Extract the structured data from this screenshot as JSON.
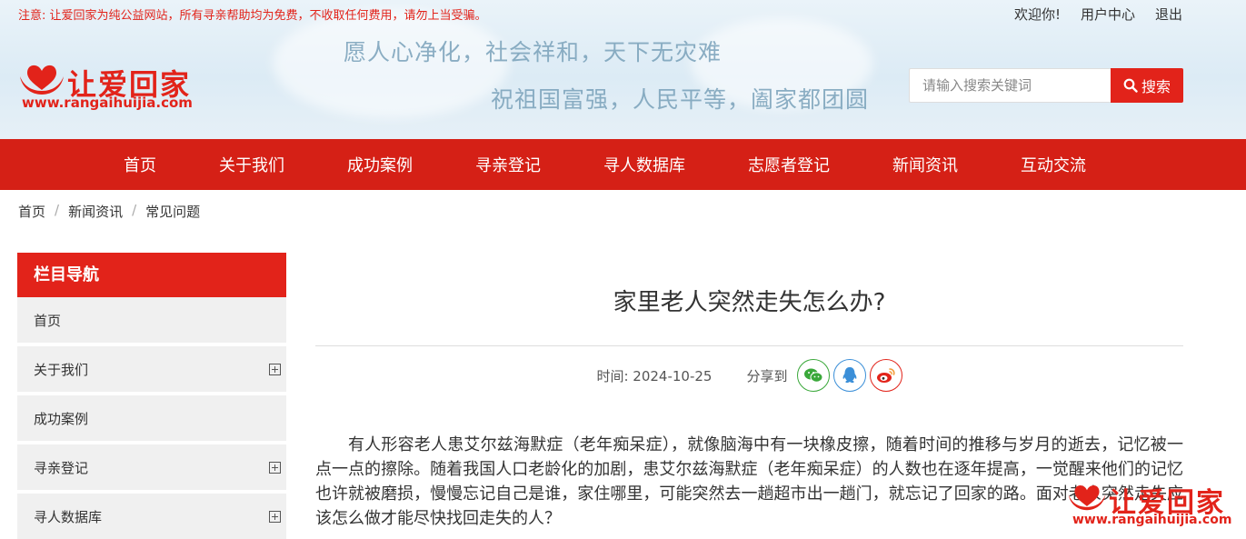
{
  "header": {
    "notice": "注意: 让爱回家为纯公益网站，所有寻亲帮助均为免费，不收取任何费用，请勿上当受骗。",
    "user_links": [
      "欢迎你!",
      "用户中心",
      "退出"
    ],
    "slogan_line1": "愿人心净化，社会祥和，天下无灾难",
    "slogan_line2": "祝祖国富强，人民平等，阖家都团圆",
    "logo_name": "让爱回家",
    "logo_url": "www.rangaihuijia.com",
    "search_placeholder": "请输入搜索关键词",
    "search_button": "搜索"
  },
  "nav": {
    "items": [
      "首页",
      "关于我们",
      "成功案例",
      "寻亲登记",
      "寻人数据库",
      "志愿者登记",
      "新闻资讯",
      "互动交流"
    ]
  },
  "breadcrumb": [
    "首页",
    "新闻资讯",
    "常见问题"
  ],
  "sidebar": {
    "title": "栏目导航",
    "items": [
      {
        "label": "首页",
        "expandable": false
      },
      {
        "label": "关于我们",
        "expandable": true
      },
      {
        "label": "成功案例",
        "expandable": false
      },
      {
        "label": "寻亲登记",
        "expandable": true
      },
      {
        "label": "寻人数据库",
        "expandable": true
      }
    ]
  },
  "article": {
    "title": "家里老人突然走失怎么办?",
    "time": "时间: 2024-10-25",
    "share_label": "分享到",
    "share_icons": [
      "wechat-icon",
      "qq-icon",
      "weibo-icon"
    ],
    "body": "有人形容老人患艾尔兹海默症（老年痴呆症），就像脑海中有一块橡皮擦，随着时间的推移与岁月的逝去，记忆被一点一点的擦除。随着我国人口老龄化的加剧，患艾尔兹海默症（老年痴呆症）的人数也在逐年提高，一觉醒来他们的记忆也许就被磨损，慢慢忘记自己是谁，家住哪里，可能突然去一趟超市出一趟门，就忘记了回家的路。面对老人突然走失应该怎么做才能尽快找回走失的人？"
  },
  "watermark": {
    "name": "让爱回家",
    "url": "www.rangaihuijia.com"
  },
  "colors": {
    "brand_red": "#e2231a",
    "nav_red": "#d52016",
    "sidebar_gray": "#f0f0f0"
  }
}
